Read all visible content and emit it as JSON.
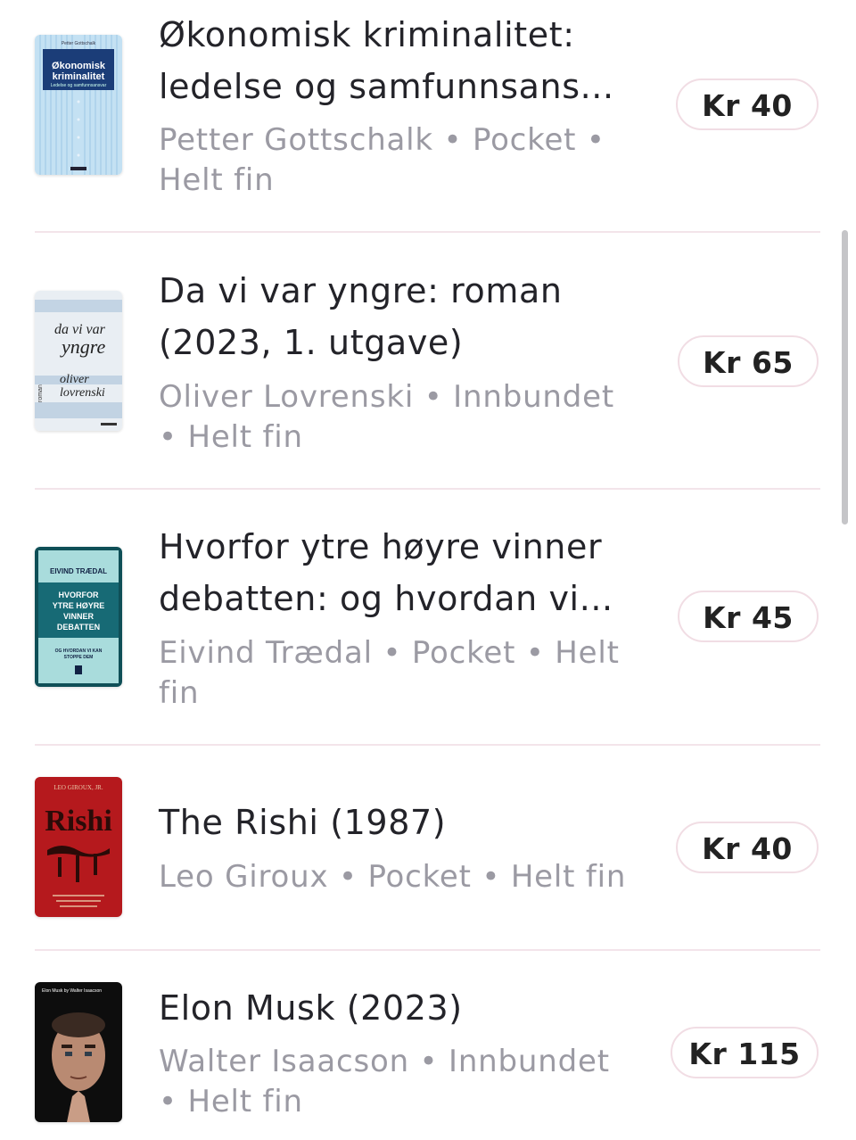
{
  "items": [
    {
      "title_line1": "Økonomisk kriminalitet:",
      "title_line2": "ledelse og samfunnsans...",
      "meta_line1": "Petter Gottschalk • Pocket •",
      "meta_line2": "Helt fin",
      "price": "Kr 40",
      "cover": {
        "author": "Petter Gottschalk",
        "title1": "Økonomisk",
        "title2": "kriminalitet",
        "subtitle": "Ledelse og samfunnsansvar",
        "color": "#bfe0f2"
      }
    },
    {
      "title_line1": "Da vi var yngre: roman",
      "title_line2": "(2023, 1. utgave)",
      "meta_line1": "Oliver Lovrenski • Innbundet",
      "meta_line2": "• Helt fin",
      "price": "Kr 65",
      "cover": {
        "title1": "da vi var",
        "title2": "yngre",
        "author1": "oliver",
        "author2": "lovrenski",
        "side": "roman",
        "color": "#e8edf2"
      }
    },
    {
      "title_line1": "Hvorfor ytre høyre vinner",
      "title_line2": "debatten: og hvordan vi...",
      "meta_line1": "Eivind Trædal • Pocket • Helt",
      "meta_line2": "fin",
      "price": "Kr 45",
      "cover": {
        "author": "EIVIND TRÆDAL",
        "t1": "HVORFOR",
        "t2": "YTRE HØYRE",
        "t3": "VINNER",
        "t4": "DEBATTEN",
        "s1": "OG HVORDAN VI KAN",
        "s2": "STOPPE DEM",
        "color": "#a8d8d8"
      }
    },
    {
      "title_line1": "The Rishi (1987)",
      "title_line2": "",
      "meta_line1": "Leo Giroux • Pocket • Helt fin",
      "meta_line2": "",
      "price": "Kr 40",
      "cover": {
        "author": "LEO GIROUX, JR.",
        "title": "Rishi",
        "color": "#b3191c"
      }
    },
    {
      "title_line1": "Elon Musk (2023)",
      "title_line2": "",
      "meta_line1": "Walter Isaacson • Innbundet",
      "meta_line2": "• Helt fin",
      "price": "Kr 115",
      "cover": {
        "text": "Elon Musk by Walter Isaacson",
        "color": "#111111"
      }
    }
  ]
}
